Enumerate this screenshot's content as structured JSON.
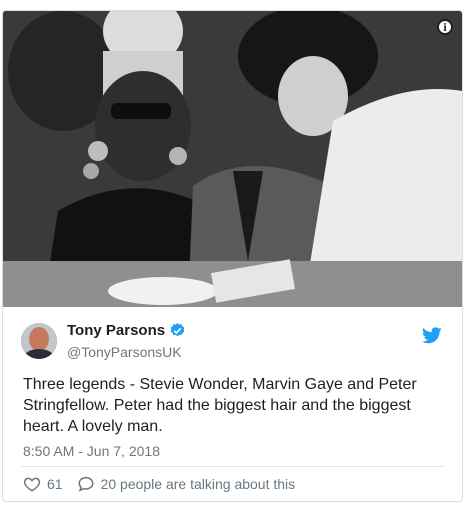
{
  "tweet": {
    "author_name": "Tony Parsons",
    "author_handle": "@TonyParsonsUK",
    "text": "Three legends - Stevie Wonder, Marvin Gaye and Peter Stringfellow. Peter had the biggest hair and the biggest heart. A lovely man.",
    "timestamp": "8:50 AM - Jun 7, 2018",
    "like_count": "61",
    "talking_text": "20 people are talking about this"
  },
  "icons": {
    "info": "info-icon",
    "verified": "verified-badge-icon",
    "brand": "twitter-bird-icon",
    "like": "heart-icon",
    "reply": "speech-bubble-icon"
  },
  "colors": {
    "twitter_blue": "#1da1f2",
    "text_primary": "#1c2022",
    "text_secondary": "#697882",
    "border": "#d6dde3"
  }
}
